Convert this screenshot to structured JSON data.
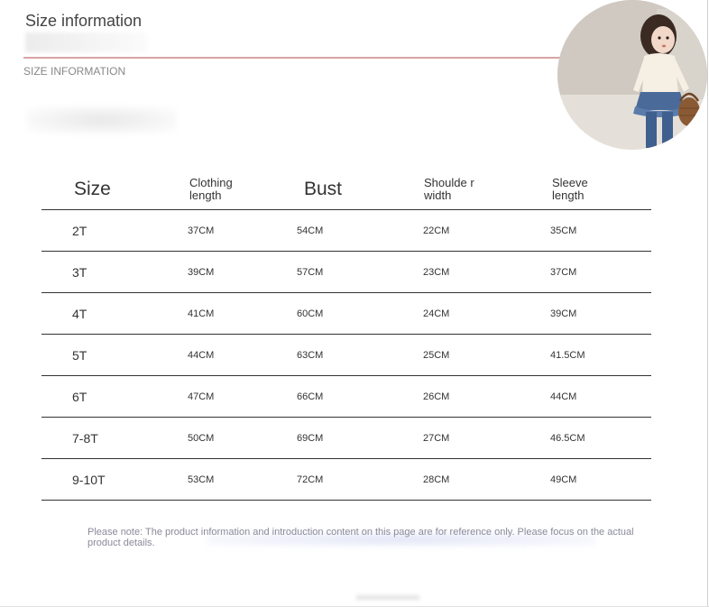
{
  "header": {
    "title": "Size information",
    "subtitle": "SIZE INFORMATION"
  },
  "table": {
    "columns": [
      "Size",
      "Clothing length",
      "Bust",
      "Shoulder width",
      "Sleeve length"
    ],
    "header_display": {
      "c0": "Size",
      "c1": "Clothing length",
      "c2": "Bust",
      "c3": "Shoulde r width",
      "c4": "Sleeve length"
    },
    "rows": [
      [
        "2T",
        "37CM",
        "54CM",
        "22CM",
        "35CM"
      ],
      [
        "3T",
        "39CM",
        "57CM",
        "23CM",
        "37CM"
      ],
      [
        "4T",
        "41CM",
        "60CM",
        "24CM",
        "39CM"
      ],
      [
        "5T",
        "44CM",
        "63CM",
        "25CM",
        "41.5CM"
      ],
      [
        "6T",
        "47CM",
        "66CM",
        "26CM",
        "44CM"
      ],
      [
        "7-8T",
        "50CM",
        "69CM",
        "27CM",
        "46.5CM"
      ],
      [
        "9-10T",
        "53CM",
        "72CM",
        "28CM",
        "49CM"
      ]
    ]
  },
  "note": "Please note: The product information and introduction content on this page are for reference only. Please focus on the actual product details.",
  "colors": {
    "rule": "#d9a4a4",
    "table_lines": "#333333",
    "note_text": "#8a8a9a"
  }
}
